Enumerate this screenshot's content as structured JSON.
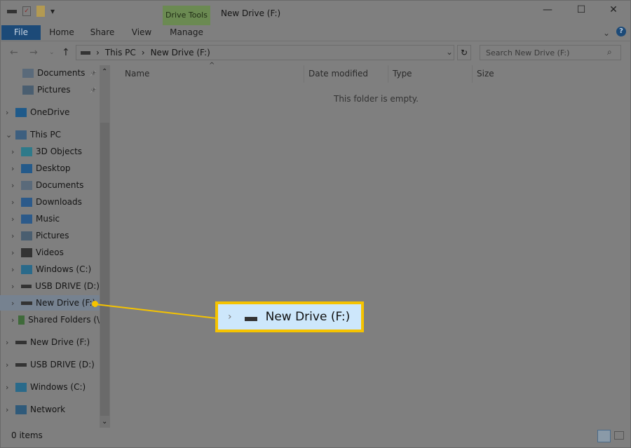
{
  "window": {
    "title": "New Drive (F:)",
    "minimize": "—",
    "maximize": "☐",
    "close": "✕"
  },
  "ribbon": {
    "tabs": [
      "File",
      "Home",
      "Share",
      "View"
    ],
    "context_group": "Drive Tools",
    "context_tab": "Manage",
    "help": "?"
  },
  "address": {
    "path": [
      "This PC",
      "New Drive (F:)"
    ],
    "search_placeholder": "Search New Drive (F:)"
  },
  "sidebar": {
    "items": [
      {
        "label": "Documents",
        "icon": "documents-icon",
        "level": 1,
        "pinned": true
      },
      {
        "label": "Pictures",
        "icon": "pictures-icon",
        "level": 1,
        "pinned": true
      },
      {
        "label": "OneDrive",
        "icon": "cloud-icon",
        "level": 0
      },
      {
        "label": "This PC",
        "icon": "computer-icon",
        "level": 0,
        "expanded": true
      },
      {
        "label": "3D Objects",
        "icon": "cube-icon",
        "level": 1
      },
      {
        "label": "Desktop",
        "icon": "desktop-icon",
        "level": 1
      },
      {
        "label": "Documents",
        "icon": "documents-icon",
        "level": 1
      },
      {
        "label": "Downloads",
        "icon": "download-icon",
        "level": 1
      },
      {
        "label": "Music",
        "icon": "music-icon",
        "level": 1
      },
      {
        "label": "Pictures",
        "icon": "pictures-icon",
        "level": 1
      },
      {
        "label": "Videos",
        "icon": "videos-icon",
        "level": 1
      },
      {
        "label": "Windows (C:)",
        "icon": "windows-drive-icon",
        "level": 1
      },
      {
        "label": "USB DRIVE (D:)",
        "icon": "drive-icon",
        "level": 1
      },
      {
        "label": "New Drive (F:)",
        "icon": "drive-icon",
        "level": 1,
        "selected": true
      },
      {
        "label": "Shared Folders (\\",
        "icon": "network-drive-icon",
        "level": 1
      },
      {
        "label": "New Drive (F:)",
        "icon": "drive-icon",
        "level": 0
      },
      {
        "label": "USB DRIVE (D:)",
        "icon": "drive-icon",
        "level": 0
      },
      {
        "label": "Windows (C:)",
        "icon": "windows-drive-icon",
        "level": 0
      },
      {
        "label": "Network",
        "icon": "network-icon",
        "level": 0
      }
    ]
  },
  "columns": [
    "Name",
    "Date modified",
    "Type",
    "Size"
  ],
  "empty_message": "This folder is empty.",
  "status": "0 items",
  "callout": {
    "label": "New Drive (F:)"
  },
  "colors": {
    "highlight": "#f5c300",
    "file_tab": "#1c4a78",
    "drive_tools": "#6b8a52"
  }
}
